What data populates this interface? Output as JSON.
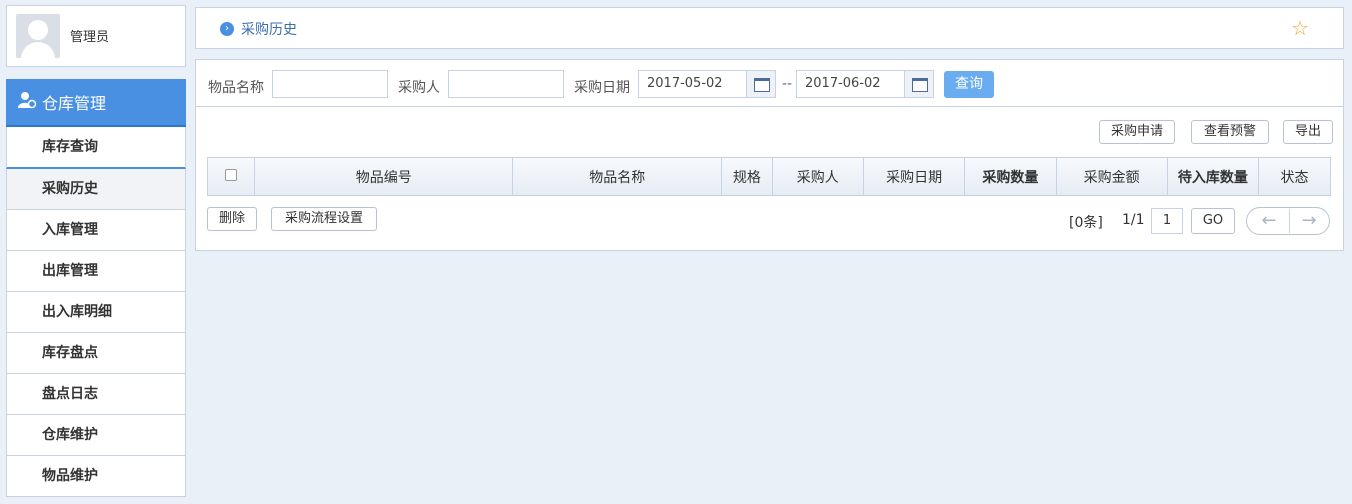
{
  "user": {
    "name": "管理员"
  },
  "nav": {
    "header": "仓库管理",
    "items": [
      {
        "label": "库存查询"
      },
      {
        "label": "采购历史"
      },
      {
        "label": "入库管理"
      },
      {
        "label": "出库管理"
      },
      {
        "label": "出入库明细"
      },
      {
        "label": "库存盘点"
      },
      {
        "label": "盘点日志"
      },
      {
        "label": "仓库维护"
      },
      {
        "label": "物品维护"
      }
    ]
  },
  "breadcrumb": {
    "current": "采购历史",
    "favorite_icon": "star-icon"
  },
  "search": {
    "item_name_label": "物品名称",
    "item_name_value": "",
    "buyer_label": "采购人",
    "buyer_value": "",
    "date_label": "采购日期",
    "date_from": "2017-05-02",
    "date_sep": "--",
    "date_to": "2017-06-02",
    "query_button": "查询"
  },
  "toolbar": {
    "apply": "采购申请",
    "warning": "查看预警",
    "export": "导出"
  },
  "table": {
    "columns": [
      "物品编号",
      "物品名称",
      "规格",
      "采购人",
      "采购日期",
      "采购数量",
      "采购金额",
      "待入库数量",
      "状态"
    ],
    "rows": []
  },
  "actions": {
    "delete": "删除",
    "flow_settings": "采购流程设置"
  },
  "pager": {
    "count": "[0条]",
    "page": "1/1",
    "page_input": "1",
    "go": "GO"
  },
  "colors": {
    "accent": "#4a90e2",
    "query_button": "#6aacf0",
    "star": "#f0a63a"
  }
}
